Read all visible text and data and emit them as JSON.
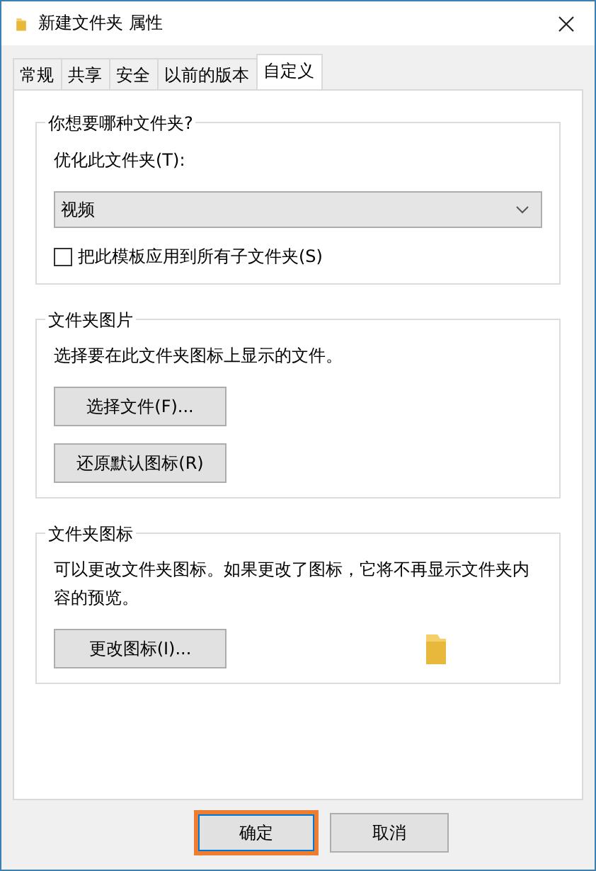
{
  "window": {
    "title": "新建文件夹 属性"
  },
  "tabs": [
    {
      "label": "常规",
      "selected": false
    },
    {
      "label": "共享",
      "selected": false
    },
    {
      "label": "安全",
      "selected": false
    },
    {
      "label": "以前的版本",
      "selected": false
    },
    {
      "label": "自定义",
      "selected": true
    }
  ],
  "folder_type": {
    "heading": "你想要哪种文件夹?",
    "label": "优化此文件夹(T):",
    "value": "视频",
    "apply_to_subfolders": {
      "label": "把此模板应用到所有子文件夹(S)",
      "checked": false
    }
  },
  "folder_picture": {
    "heading": "文件夹图片",
    "description": "选择要在此文件夹图标上显示的文件。",
    "buttons": [
      "选择文件(F)...",
      "还原默认图标(R)"
    ]
  },
  "folder_icon": {
    "heading": "文件夹图标",
    "description": "可以更改文件夹图标。如果更改了图标，它将不再显示文件夹内容的预览。",
    "button": "更改图标(I)..."
  },
  "buttons": [
    {
      "label": "确定",
      "highlighted": true
    },
    {
      "label": "取消",
      "highlighted": false
    }
  ]
}
